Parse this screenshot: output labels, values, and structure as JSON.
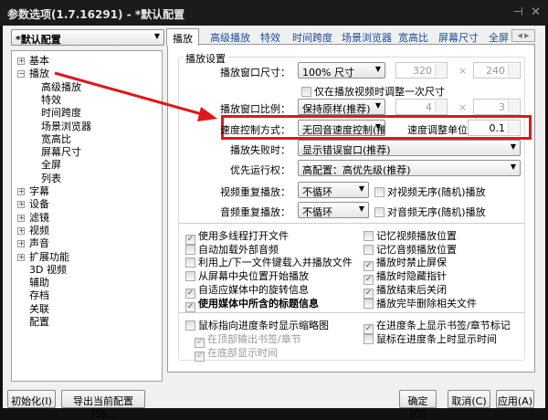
{
  "window": {
    "title": "参数选项(1.7.16291) - *默认配置",
    "pin": "⊣",
    "close": "✕"
  },
  "profile": {
    "value": "*默认配置"
  },
  "tree": [
    {
      "label": "基本",
      "exp": "+",
      "lvl": 0
    },
    {
      "label": "播放",
      "exp": "-",
      "lvl": 0
    },
    {
      "label": "高级播放",
      "lvl": 1
    },
    {
      "label": "特效",
      "lvl": 1
    },
    {
      "label": "时间跨度",
      "lvl": 1
    },
    {
      "label": "场景浏览器",
      "lvl": 1
    },
    {
      "label": "宽高比",
      "lvl": 1
    },
    {
      "label": "屏幕尺寸",
      "lvl": 1
    },
    {
      "label": "全屏",
      "lvl": 1
    },
    {
      "label": "列表",
      "lvl": 1
    },
    {
      "label": "字幕",
      "exp": "+",
      "lvl": 0
    },
    {
      "label": "设备",
      "exp": "+",
      "lvl": 0
    },
    {
      "label": "滤镜",
      "exp": "+",
      "lvl": 0
    },
    {
      "label": "视频",
      "exp": "+",
      "lvl": 0
    },
    {
      "label": "声音",
      "exp": "+",
      "lvl": 0
    },
    {
      "label": "扩展功能",
      "exp": "+",
      "lvl": 0
    },
    {
      "label": "3D 视频",
      "lvl": 0
    },
    {
      "label": "辅助",
      "lvl": 0
    },
    {
      "label": "存档",
      "lvl": 0
    },
    {
      "label": "关联",
      "lvl": 0
    },
    {
      "label": "配置",
      "lvl": 0
    }
  ],
  "tabs": [
    "播放",
    "高级播放",
    "特效",
    "时间跨度",
    "场景浏览器",
    "宽高比",
    "屏幕尺寸",
    "全屏"
  ],
  "group_title": "播放设置",
  "rows": {
    "size": {
      "label": "播放窗口尺寸：",
      "value": "100% 尺寸",
      "w": "320",
      "h": "240",
      "x": "×"
    },
    "once": {
      "label": "仅在播放视频时调整一次尺寸",
      "checked": false
    },
    "ratio": {
      "label": "播放窗口比例：",
      "value": "保持原样(推荐)",
      "w": "4",
      "h": "3",
      "x": "×"
    },
    "speed": {
      "label": "速度控制方式：",
      "value": "无回音速度控制(推",
      "unit_label": "速度调整单位：",
      "unit": "0.1"
    },
    "fail": {
      "label": "播放失败时：",
      "value": "显示错误窗口(推荐)"
    },
    "priority": {
      "label": "优先运行权：",
      "value": "高配置：高优先级(推荐)"
    },
    "vrepeat": {
      "label": "视频重复播放：",
      "value": "不循环",
      "rand": "对视频无序(随机)播放"
    },
    "arepeat": {
      "label": "音频重复播放：",
      "value": "不循环",
      "rand": "对音频无序(随机)播放"
    }
  },
  "checks_left": [
    {
      "label": "使用多线程打开文件",
      "checked": true
    },
    {
      "label": "自动加载外部音频",
      "checked": false
    },
    {
      "label": "利用上/下一文件键载入并播放文件",
      "checked": false
    },
    {
      "label": "从屏幕中央位置开始播放",
      "checked": false
    },
    {
      "label": "自适应媒体中的旋转信息",
      "checked": true
    },
    {
      "label": "使用媒体中所含的标题信息",
      "checked": true
    }
  ],
  "checks_right": [
    {
      "label": "记忆视频播放位置",
      "checked": false
    },
    {
      "label": "记忆音频播放位置",
      "checked": false
    },
    {
      "label": "播放时禁止屏保",
      "checked": true
    },
    {
      "label": "播放时隐藏指针",
      "checked": true
    },
    {
      "label": "播放结束后关闭",
      "checked": true
    },
    {
      "label": "播放完毕删除相关文件",
      "checked": false
    }
  ],
  "checks2_left": [
    {
      "label": "鼠标指向进度条时显示缩略图",
      "checked": false
    },
    {
      "label": "在顶部输出书签/章节",
      "checked": true,
      "disabled": true
    },
    {
      "label": "在底部显示时间",
      "checked": true,
      "disabled": true
    }
  ],
  "checks2_right": [
    {
      "label": "在进度条上显示书签/章节标记",
      "checked": true
    },
    {
      "label": "鼠标在进度条上时显示时间",
      "checked": false
    }
  ],
  "buttons": {
    "init": "初始化(I)",
    "export": "导出当前配置(S)...",
    "ok": "确定(O)",
    "cancel": "取消(C)",
    "apply": "应用(A)"
  },
  "colors": {
    "highlight": "#e01818",
    "titlebar": "#1b1b1b"
  }
}
